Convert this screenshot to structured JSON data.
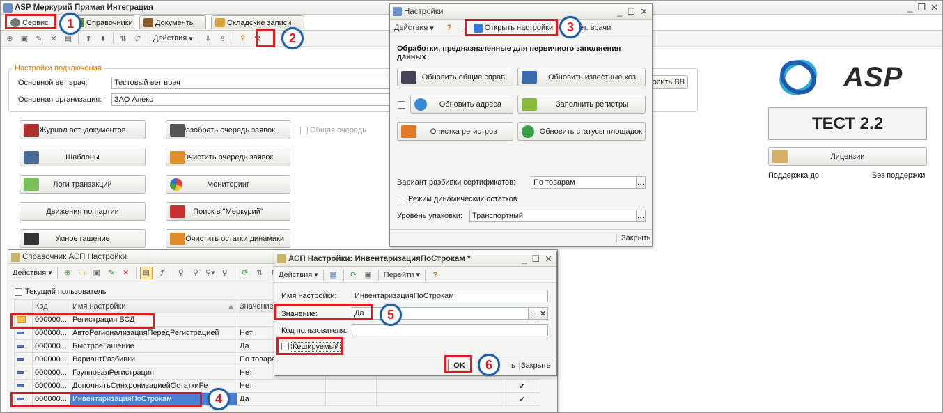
{
  "main_window": {
    "title": "ASP Меркурий Прямая Интеграция",
    "tabs": [
      "Сервис",
      "Справочники",
      "Документы",
      "Складские записи"
    ],
    "actions_label": "Действия"
  },
  "connection": {
    "group_title": "Настройки подключения",
    "vet_label": "Основной вет врач:",
    "vet_value": "Тестовый вет врач",
    "org_label": "Основная организация:",
    "org_value": "ЗАО  Алекс",
    "right_button": "осить ВВ"
  },
  "left_buttons": [
    "Журнал вет. документов",
    "Шаблоны",
    "Логи транзакций",
    "Движения по партии",
    "Умное гашение"
  ],
  "mid_buttons": [
    "Разобрать очередь заявок",
    "Очистить очередь заявок",
    "Мониторинг",
    "Поиск в \"Меркурий\"",
    "Очистить остатки динамики"
  ],
  "common_queue_label": "Общая очередь",
  "brand": {
    "logo_text": "ASP",
    "version": "ТЕСТ 2.2",
    "licenses_label": "Лицензии",
    "support_label": "Поддержка до:",
    "support_value": "Без поддержки"
  },
  "settings_window": {
    "title": "Настройки",
    "actions_label": "Действия",
    "open_settings_label": "Открыть настройки",
    "known_vets_label": "ые вет. врачи",
    "section_title": "Обработки, предназначенные для первичного заполнения данных",
    "buttons": [
      "Обновить общие справ.",
      "Обновить известные хоз.",
      "Обновить адреса",
      "Заполнить регистры",
      "Очистка регистров",
      "Обновить статусы площадок"
    ],
    "split_label": "Вариант разбивки сертификатов:",
    "split_value": "По товарам",
    "dynamic_label": "Режим динамических остатков",
    "pack_label": "Уровень упаковки:",
    "pack_value": "Транспортный",
    "close_label": "Закрыть"
  },
  "catalog_window": {
    "title": "Справочник АСП Настройки",
    "actions_label": "Действия",
    "current_user_label": "Текущий пользователь",
    "toolbar_cut": "П",
    "columns": [
      "Код",
      "Имя настройки",
      "Значение"
    ],
    "rows": [
      {
        "code": "000000...",
        "name": "Регистрация ВСД",
        "value": "",
        "folder": true
      },
      {
        "code": "000000...",
        "name": "АвтоРегионализацияПередРегистрацией",
        "value": "Нет"
      },
      {
        "code": "000000...",
        "name": "БыстроеГашение",
        "value": "Да"
      },
      {
        "code": "000000...",
        "name": "ВариантРазбивки",
        "value": "По товара"
      },
      {
        "code": "000000...",
        "name": "ГрупповаяРегистрация",
        "value": "Нет"
      },
      {
        "code": "000000...",
        "name": "ДополнятьСинхронизациейОстаткиРе",
        "value": "Нет"
      },
      {
        "code": "000000...",
        "name": "ИнвентаризацияПоСтрокам",
        "value": "Да",
        "selected": true
      }
    ],
    "checkmark": "✔"
  },
  "edit_window": {
    "title": "АСП Настройки: ИнвентаризацияПоСтрокам *",
    "actions_label": "Действия",
    "goto_label": "Перейти",
    "name_label": "Имя настройки:",
    "name_value": "ИнвентаризацияПоСтрокам",
    "value_label": "Значение:",
    "value_value": "Да",
    "user_code_label": "Код пользователя:",
    "cached_label": "Кешируемый",
    "ok_label": "OK",
    "close_label": "Закрыть",
    "cut_label": "ь"
  },
  "callouts": [
    "1",
    "2",
    "3",
    "4",
    "5",
    "6"
  ],
  "colors": {
    "highlight": "#e01b22",
    "badge_border": "#1f5fa8",
    "selection": "#4a7fd3",
    "group_title": "#d07a00"
  }
}
